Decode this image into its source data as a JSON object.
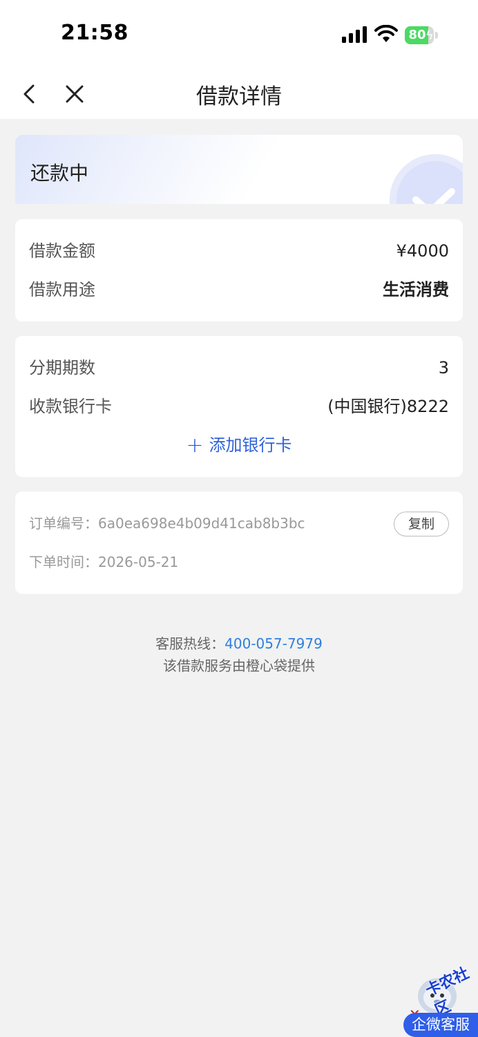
{
  "status_bar": {
    "time": "21:58",
    "battery_percent": "80",
    "battery_level": 0.8,
    "battery_color": "#4cd964"
  },
  "nav": {
    "title": "借款详情",
    "back_icon": "chevron-left-icon",
    "close_icon": "close-icon"
  },
  "status": {
    "text": "还款中",
    "icon": "check-circle-icon"
  },
  "loan_info": {
    "amount_label": "借款金额",
    "amount_value": "¥4000",
    "purpose_label": "借款用途",
    "purpose_value": "生活消费"
  },
  "installment_info": {
    "periods_label": "分期期数",
    "periods_value": "3",
    "bank_label": "收款银行卡",
    "bank_value": "(中国银行)8222",
    "add_card_label": "添加银行卡",
    "accent_color": "#2f63d9"
  },
  "order": {
    "number_label": "订单编号：",
    "number_value": "6a0ea698e4b09d41cab8b3bc",
    "copy_label": "复制",
    "time_label": "下单时间：",
    "time_value": "2026-05-21"
  },
  "footer": {
    "hotline_label": "客服热线：",
    "hotline_number": "400-057-7979",
    "provider_text": "该借款服务由橙心袋提供"
  },
  "overlay": {
    "watermark_text": "卡农社区",
    "cs_button_label": "企微客服"
  }
}
